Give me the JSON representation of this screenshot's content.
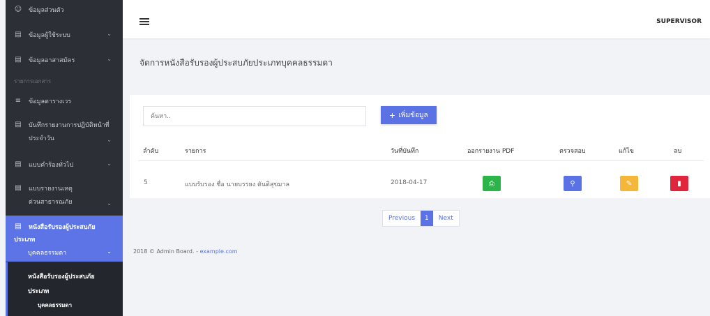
{
  "header": {
    "role": "SUPERVISOR"
  },
  "sidebar": {
    "items": [
      {
        "label": "ข้อมูลส่วนตัว",
        "icon": "user-icon"
      },
      {
        "label": "ข้อมูลผู้ใช้ระบบ",
        "icon": "id-card-icon"
      },
      {
        "label": "ข้อมูลอาสาสมัคร",
        "icon": "id-card-icon"
      },
      {
        "label": "ข้อมูลตารางเวร",
        "icon": "list-icon"
      },
      {
        "label": "บันทึกรายงานการปฏิบัติหน้าที่",
        "label2": "ประจำวัน",
        "icon": "document-icon"
      },
      {
        "label": "แบบคำร้องทั่วไป",
        "icon": "document-icon"
      },
      {
        "label": "แบบรายงานเหตุ",
        "label2": "ด่วนสาธารณภัย",
        "icon": "document-icon"
      }
    ],
    "section": "รายการเอกสาร",
    "active": {
      "label": "หนังสือรับรองผู้ประสบภัย",
      "label2": "ประเภท",
      "label3": "บุคคลธรรมดา"
    },
    "sub": {
      "label": "หนังสือรับรองผู้ประสบภัย",
      "label2": "ประเภท",
      "label3": "บุคคลธรรมดา"
    }
  },
  "page": {
    "title": "จัดการหนังสือรับรองผู้ประสบภัยประเภทบุคคลธรรมดา"
  },
  "search": {
    "placeholder": "ค้นหา.."
  },
  "add_button": {
    "label": "เพิ่มข้อมูล"
  },
  "table": {
    "headers": [
      "ลำดับ",
      "รายการ",
      "วันที่บันทึก",
      "ออกรายงาน PDF",
      "ตรวจสอบ",
      "แก้ไข",
      "ลบ"
    ],
    "rows": [
      {
        "no": "5",
        "item": "แบบรับรอง ชื่อ นายบรรยง ตันติสุขมาล",
        "date": "2018-04-17"
      }
    ]
  },
  "pagination": {
    "previous": "Previous",
    "current": "1",
    "next": "Next"
  },
  "footer": {
    "text": "2018 © Admin Board. - ",
    "link": "example.com"
  },
  "colors": {
    "accent": "#5a72e4",
    "green": "#2bb44a",
    "blue": "#5a72e4",
    "yellow": "#f4b73a",
    "red": "#e0263c"
  }
}
